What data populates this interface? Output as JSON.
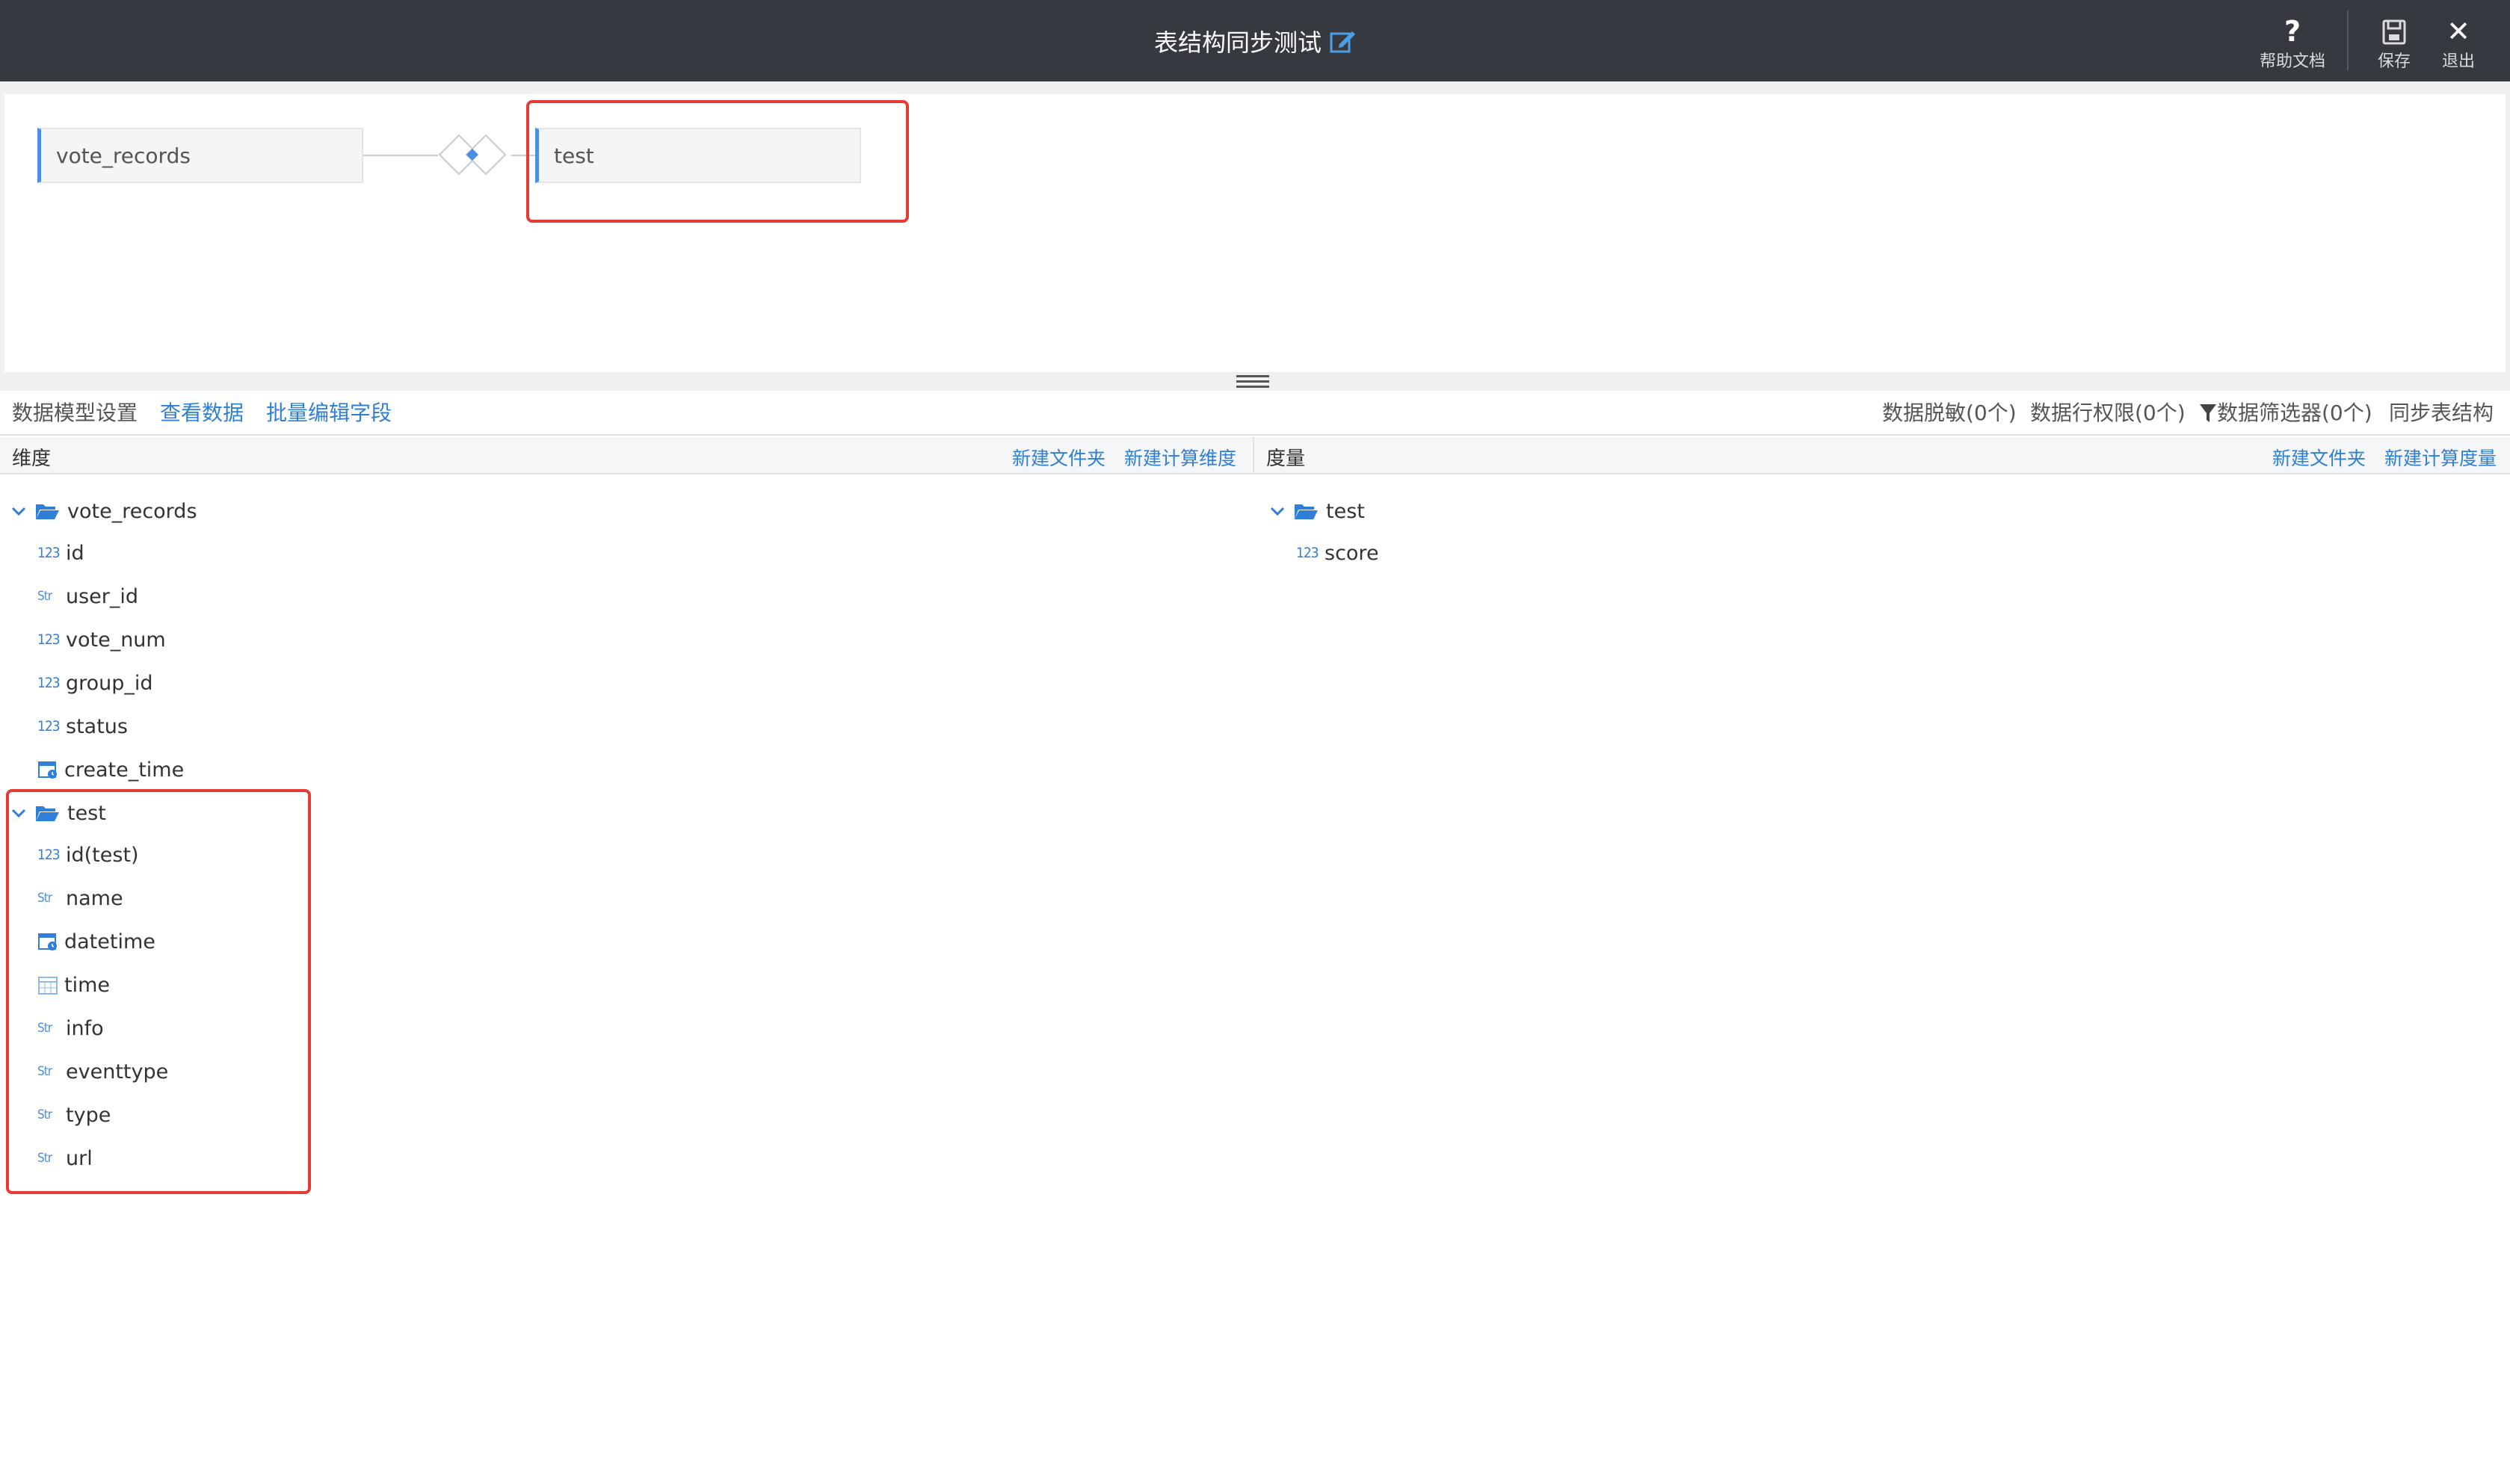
{
  "header": {
    "title": "表结构同步测试",
    "actions": [
      {
        "label": "帮助文档",
        "icon": "help-icon",
        "glyph": "?"
      },
      {
        "label": "保存",
        "icon": "save-icon"
      },
      {
        "label": "退出",
        "icon": "close-icon",
        "glyph": "✕"
      }
    ]
  },
  "join": {
    "left_table": "vote_records",
    "right_table": "test"
  },
  "toolbar": {
    "left": {
      "settings_label": "数据模型设置",
      "view_data": "查看数据",
      "batch_edit": "批量编辑字段"
    },
    "right": {
      "masking": "数据脱敏(0个)",
      "row_permission": "数据行权限(0个)",
      "filter": "数据筛选器(0个)",
      "sync": "同步表结构"
    }
  },
  "dimensions": {
    "title": "维度",
    "new_folder": "新建文件夹",
    "new_calc": "新建计算维度",
    "groups": [
      {
        "name": "vote_records",
        "fields": [
          {
            "type": "123",
            "name": "id"
          },
          {
            "type": "Str",
            "name": "user_id"
          },
          {
            "type": "123",
            "name": "vote_num"
          },
          {
            "type": "123",
            "name": "group_id"
          },
          {
            "type": "123",
            "name": "status"
          },
          {
            "type": "datetime",
            "name": "create_time"
          }
        ]
      },
      {
        "name": "test",
        "fields": [
          {
            "type": "123",
            "name": "id(test)"
          },
          {
            "type": "Str",
            "name": "name"
          },
          {
            "type": "datetime",
            "name": "datetime"
          },
          {
            "type": "date",
            "name": "time"
          },
          {
            "type": "Str",
            "name": "info"
          },
          {
            "type": "Str",
            "name": "eventtype"
          },
          {
            "type": "Str",
            "name": "type"
          },
          {
            "type": "Str",
            "name": "url"
          }
        ]
      }
    ]
  },
  "measures": {
    "title": "度量",
    "new_folder": "新建文件夹",
    "new_calc": "新建计算度量",
    "groups": [
      {
        "name": "test",
        "fields": [
          {
            "type": "123",
            "name": "score"
          }
        ]
      }
    ]
  },
  "colors": {
    "topbar": "#363a40",
    "link": "#2f7fd8",
    "highlight": "#e63a32"
  }
}
